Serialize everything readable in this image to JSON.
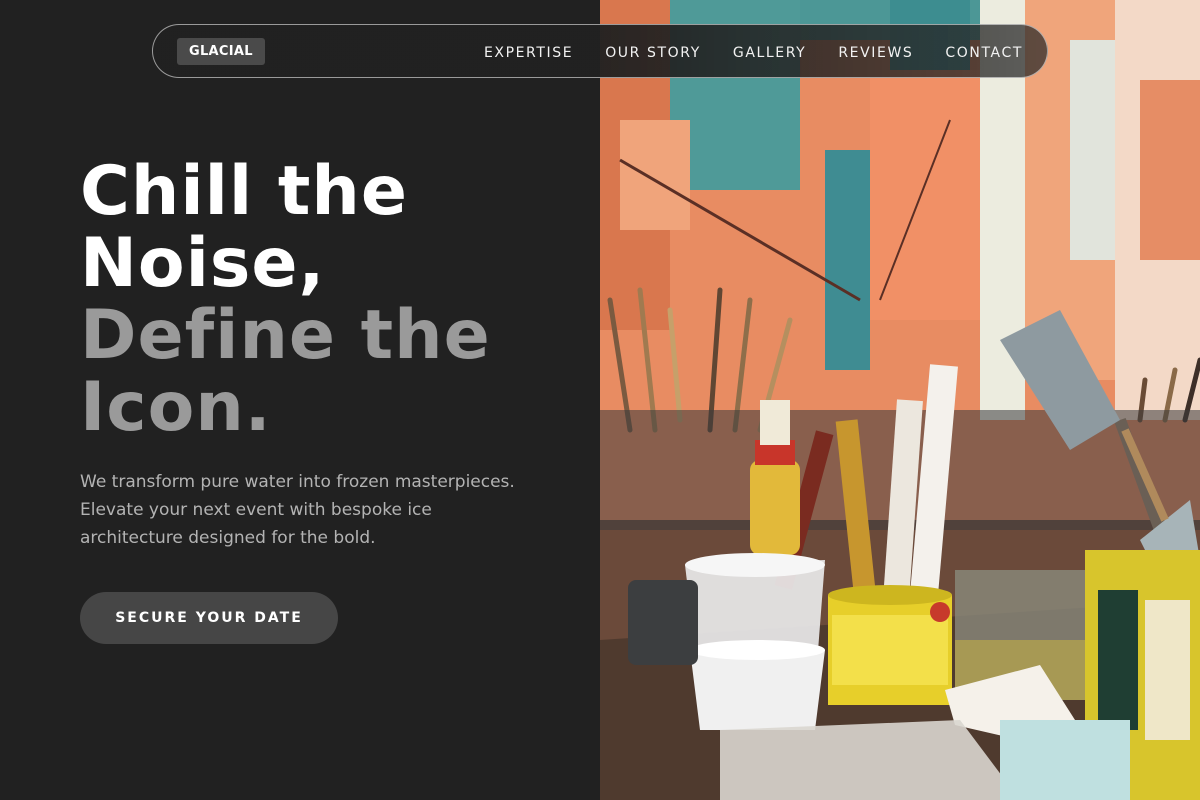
{
  "brand": {
    "logo_text": "GLACIAL"
  },
  "nav": {
    "links": [
      {
        "label": "EXPERTISE"
      },
      {
        "label": "OUR STORY"
      },
      {
        "label": "GALLERY"
      },
      {
        "label": "REVIEWS"
      },
      {
        "label": "CONTACT"
      }
    ]
  },
  "hero": {
    "headline_lines": [
      {
        "text": "Chill the",
        "tone": "white"
      },
      {
        "text": "Noise,",
        "tone": "white"
      },
      {
        "text": "Define the",
        "tone": "grey"
      },
      {
        "text": "Icon.",
        "tone": "grey"
      }
    ],
    "subtext": "We transform pure water into frozen masterpieces. Elevate your next event with bespoke ice architecture designed for the bold.",
    "cta_label": "SECURE YOUR DATE",
    "image": {
      "subject": "artist studio table with paint brushes in jars and paint cans",
      "icon": "photo-image"
    }
  },
  "colors": {
    "background": "#212121",
    "headline_white": "#ffffff",
    "headline_grey": "#9a9a9a",
    "cta_bg": "#464646",
    "logo_bg": "#4a4a4a"
  }
}
